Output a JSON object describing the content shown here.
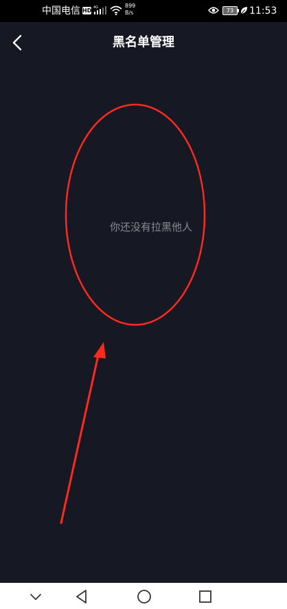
{
  "status_bar": {
    "carrier": "中国电信",
    "hd_badge": "HD",
    "signal_label": "4G",
    "net_speed_value": "899",
    "net_speed_unit": "B/s",
    "battery_level": "73",
    "time": "11:53",
    "icons": [
      "signal-icon",
      "wifi-icon",
      "eye-icon",
      "battery-icon",
      "leaf-icon"
    ]
  },
  "header": {
    "title": "黑名单管理",
    "back_icon": "chevron-left-icon"
  },
  "main": {
    "empty_message": "你还没有拉黑他人"
  },
  "annotation": {
    "color": "#ff2a1f",
    "shapes": [
      "ellipse",
      "arrow"
    ]
  },
  "nav_bar": {
    "buttons": [
      "chevron-down-icon",
      "back-triangle-icon",
      "home-circle-icon",
      "recents-square-icon"
    ]
  },
  "colors": {
    "background": "#161823",
    "status_bar_bg": "#000000",
    "title_text": "#ffffff",
    "empty_text": "#8a8b91",
    "nav_bar_bg": "#ffffff"
  }
}
